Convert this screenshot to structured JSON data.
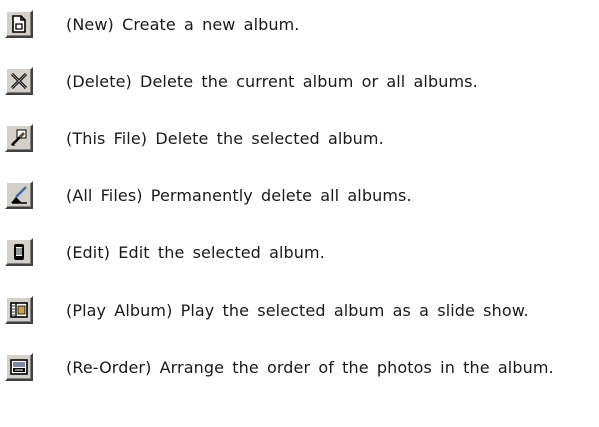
{
  "items": [
    {
      "icon": "new-document-icon",
      "text": "(New) Create a new album."
    },
    {
      "icon": "delete-x-icon",
      "text": "(Delete) Delete the current album or all albums."
    },
    {
      "icon": "delete-this-file-icon",
      "text": "(This File) Delete the selected album."
    },
    {
      "icon": "delete-all-files-icon",
      "text": "(All Files) Permanently delete all albums."
    },
    {
      "icon": "edit-album-icon",
      "text": "(Edit) Edit the selected album."
    },
    {
      "icon": "play-album-icon",
      "text": "(Play Album) Play the selected album as a slide show."
    },
    {
      "icon": "reorder-photos-icon",
      "text": "(Re-Order) Arrange the order of the photos in the album."
    }
  ]
}
